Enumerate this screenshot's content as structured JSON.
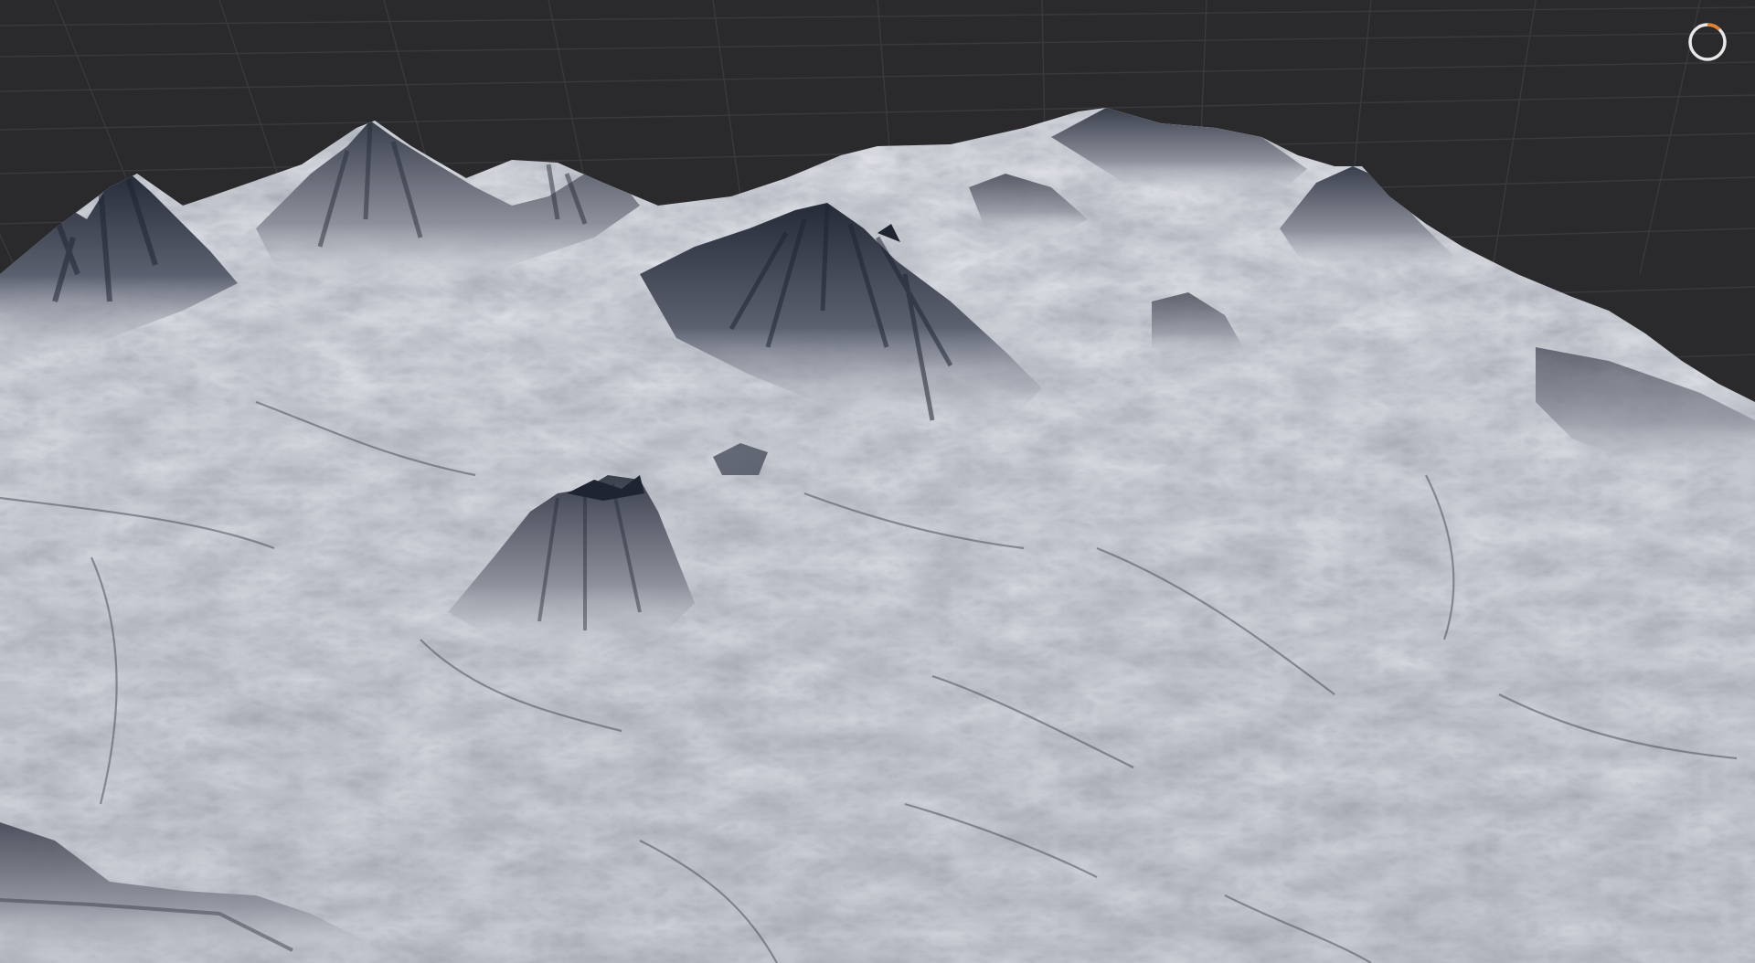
{
  "viewport": {
    "background_color": "#2a2a2c",
    "grid_line_color": "#3a3a3d",
    "terrain_color": "#d9dce2",
    "terrain_shadow_color": "#2c3140"
  },
  "progress_indicator": {
    "icon": "loading-spinner-icon",
    "progress": 0.12,
    "track_color": "#e8e8e8",
    "arc_color": "#e8822a"
  }
}
